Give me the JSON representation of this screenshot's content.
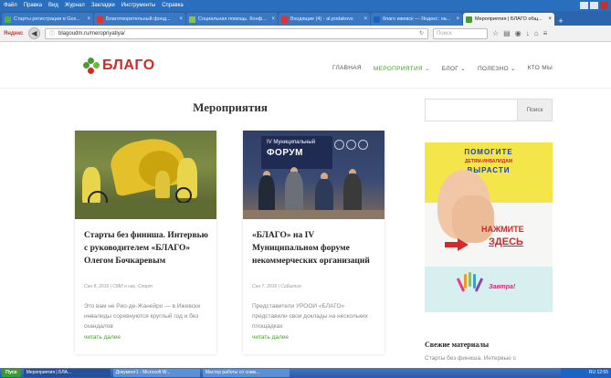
{
  "browser": {
    "menu": [
      "Файл",
      "Правка",
      "Вид",
      "Журнал",
      "Закладки",
      "Инструменты",
      "Справка"
    ],
    "tabs": [
      {
        "label": "Старты регистрации в Gos...",
        "color": "#4caf50",
        "active": false
      },
      {
        "label": "Благотворительный фонд...",
        "color": "#d33",
        "active": false
      },
      {
        "label": "Социальная помощь. Конф...",
        "color": "#8bc34a",
        "active": false
      },
      {
        "label": "Входящие (4) - al.podakovs",
        "color": "#d33",
        "active": false
      },
      {
        "label": "благо ижевск — Яндекс: на...",
        "color": "#1565c0",
        "active": false
      },
      {
        "label": "Мероприятия | БЛАГО общ...",
        "color": "#4a9a32",
        "active": true
      }
    ],
    "yandex_label": "Яндекс",
    "url": "blagoudm.ru/meropriyatiya/",
    "search_placeholder": "Поиск"
  },
  "site": {
    "logo_text": "БЛАГО",
    "nav": [
      {
        "label": "ГЛАВНАЯ",
        "active": false
      },
      {
        "label": "МЕРОПРИЯТИЯ ⌄",
        "active": true
      },
      {
        "label": "БЛОГ ⌄",
        "active": false
      },
      {
        "label": "ПОЛЕЗНО ⌄",
        "active": false
      },
      {
        "label": "КТО МЫ",
        "active": false
      }
    ],
    "page_title": "Мероприятия",
    "posts": [
      {
        "title": "Старты без финиша. Интервью с руководителем «БЛАГО» Олегом Бочкаревым",
        "meta": "Сен 8, 2016 | СМИ о нас, Спорт",
        "excerpt": "Это вам не Рио-де-Жанейро — в Ижевске инвалиды соревнуются круглый год и без скандалов",
        "more": "читать далее"
      },
      {
        "title": "«БЛАГО» на IV Муниципальном форуме некоммерческих организаций",
        "meta": "Сен 7, 2016 | События",
        "excerpt": "Представители УРООИ «БЛАГО» представили свои доклады на нескольких площадках",
        "more": "читать далее",
        "photo_banner_small": "IV Муниципальный",
        "photo_banner_big": "ФОРУМ"
      }
    ],
    "sidebar": {
      "search_button": "Поиск",
      "ad": {
        "line1": "ПОМОГИТЕ",
        "line2": "ДЕТЯМ-ИНВАЛИДАМ",
        "line3": "ВЫРАСТИ",
        "click1": "НАЖМИТЕ",
        "click2": "ЗДЕСЬ",
        "tomorrow": "Завтра!"
      },
      "recent_heading": "Свежие материалы",
      "recent_first": "Старты без финиша. Интервью с"
    }
  },
  "taskbar": {
    "start": "Пуск",
    "items": [
      {
        "label": "Мероприятия | БЛА...",
        "active": true
      },
      {
        "label": "Документ1 - Microsoft W...",
        "active": false
      },
      {
        "label": "Мастер работы со сним...",
        "active": false
      }
    ],
    "tray": "RU  12:55"
  }
}
